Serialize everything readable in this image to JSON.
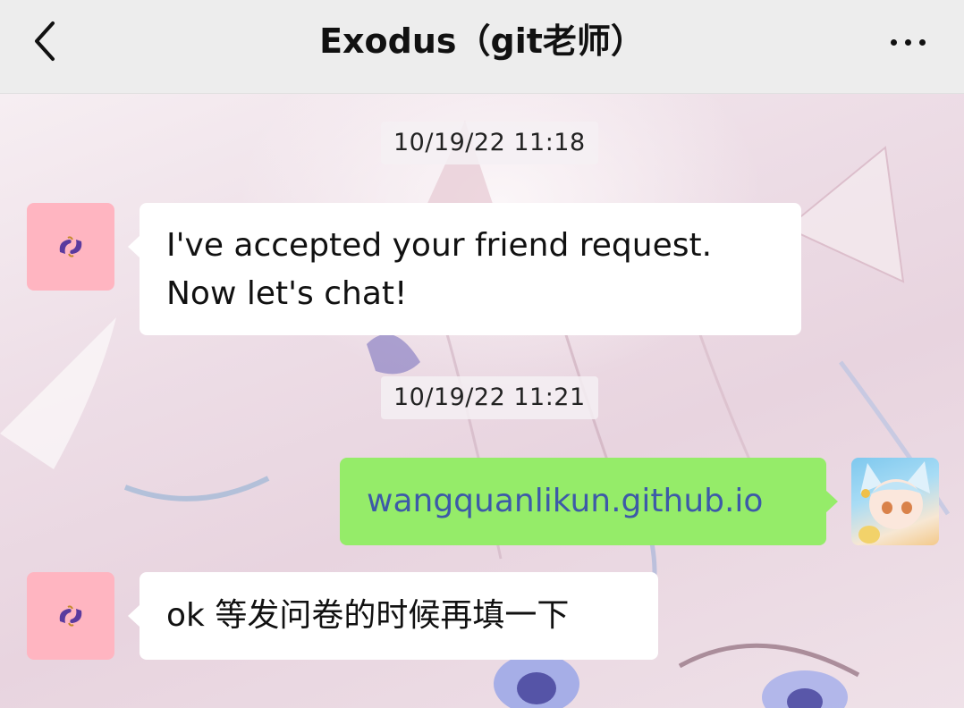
{
  "header": {
    "title": "Exodus（git老师）",
    "back_icon": "chevron-left-icon",
    "more_icon": "ellipsis-icon"
  },
  "messages": [
    {
      "type": "timestamp",
      "text": "10/19/22 11:18"
    },
    {
      "type": "incoming",
      "sender_avatar": "eggplant-avatar",
      "lines": [
        "I've accepted your friend request.",
        "Now let's chat!"
      ]
    },
    {
      "type": "timestamp",
      "text": "10/19/22 11:21"
    },
    {
      "type": "outgoing",
      "sender_avatar": "anime-girl-avatar",
      "text": "wangquanlikun.github.io",
      "is_link": true
    },
    {
      "type": "incoming",
      "sender_avatar": "eggplant-avatar",
      "text": "ok 等发问卷的时候再填一下"
    }
  ],
  "colors": {
    "navbar_bg": "#ededed",
    "outgoing_bubble": "#95ec69",
    "incoming_bubble": "#ffffff",
    "link_text": "#3d5aa8",
    "friend_avatar_bg": "#ffb5c1"
  }
}
